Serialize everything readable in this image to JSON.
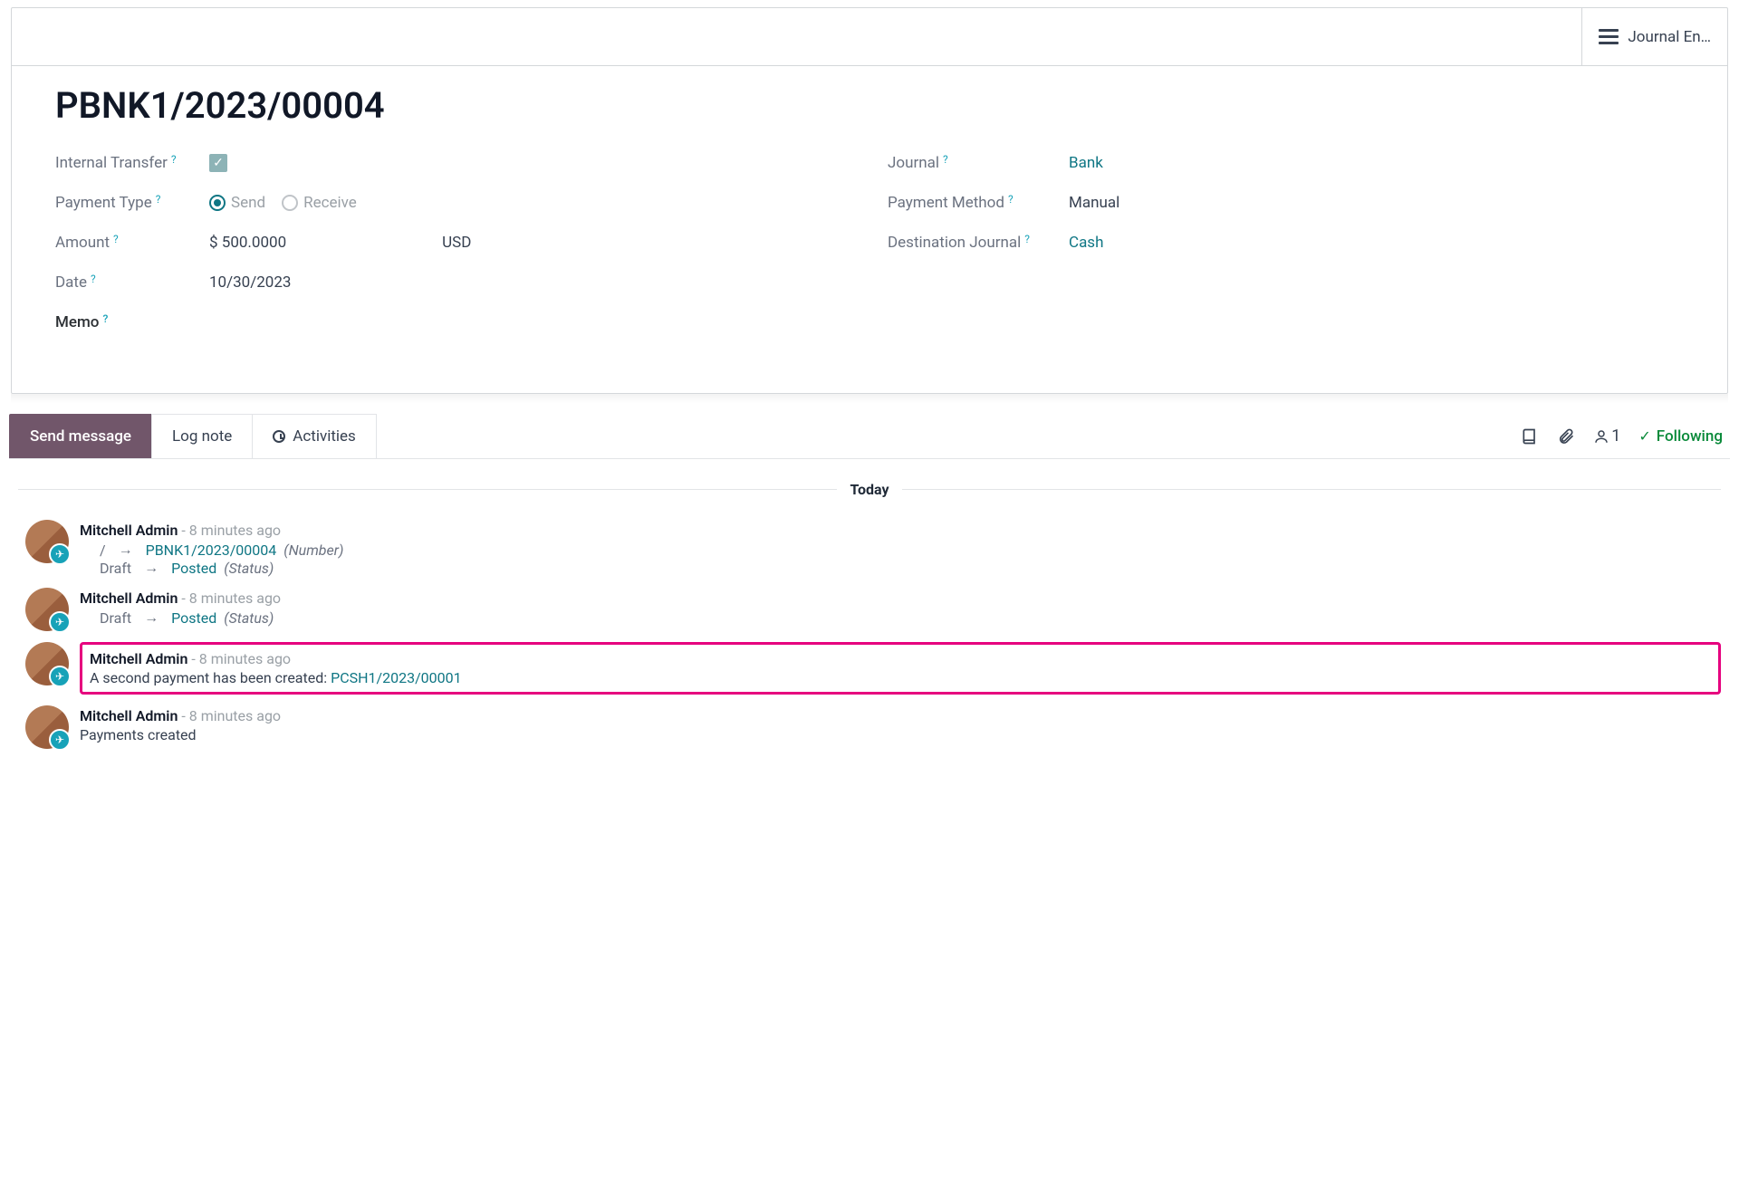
{
  "header": {
    "journal_entries_label": "Journal En…"
  },
  "record": {
    "title": "PBNK1/2023/00004",
    "fields": {
      "internal_transfer_label": "Internal Transfer",
      "internal_transfer_checked": true,
      "payment_type_label": "Payment Type",
      "payment_type_options": {
        "send": "Send",
        "receive": "Receive"
      },
      "payment_type_value": "send",
      "amount_label": "Amount",
      "amount_value": "$ 500.0000",
      "amount_currency": "USD",
      "date_label": "Date",
      "date_value": "10/30/2023",
      "memo_label": "Memo",
      "journal_label": "Journal",
      "journal_value": "Bank",
      "payment_method_label": "Payment Method",
      "payment_method_value": "Manual",
      "destination_journal_label": "Destination Journal",
      "destination_journal_value": "Cash"
    }
  },
  "chatter": {
    "tabs": {
      "send_message": "Send message",
      "log_note": "Log note",
      "activities": "Activities"
    },
    "followers_count": "1",
    "following_label": "Following",
    "today_label": "Today",
    "messages": [
      {
        "author": "Mitchell Admin",
        "time": "- 8 minutes ago",
        "lines": [
          {
            "prefix": "/",
            "arrow": "→",
            "link": "PBNK1/2023/00004",
            "suffix_italic": "(Number)"
          },
          {
            "prefix": "Draft",
            "arrow": "→",
            "link": "Posted",
            "suffix_italic": "(Status)"
          }
        ]
      },
      {
        "author": "Mitchell Admin",
        "time": "- 8 minutes ago",
        "lines": [
          {
            "prefix": "Draft",
            "arrow": "→",
            "link": "Posted",
            "suffix_italic": "(Status)"
          }
        ]
      },
      {
        "author": "Mitchell Admin",
        "time": "- 8 minutes ago",
        "highlight": true,
        "plain": {
          "text": "A second payment has been created: ",
          "link": "PCSH1/2023/00001"
        }
      },
      {
        "author": "Mitchell Admin",
        "time": "- 8 minutes ago",
        "plain": {
          "text": "Payments created"
        }
      }
    ]
  }
}
